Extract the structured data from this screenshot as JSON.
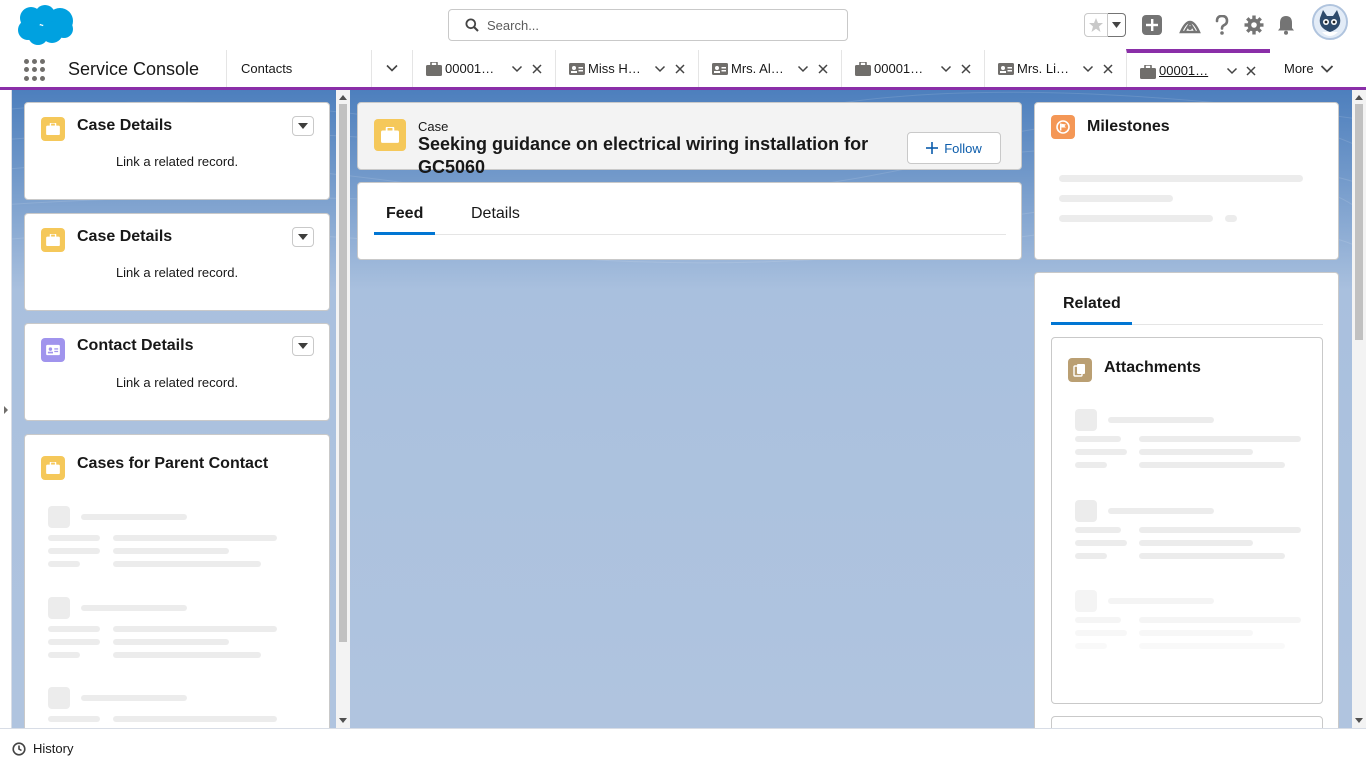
{
  "header": {
    "search_placeholder": "Search...",
    "icons": [
      "salesforce-cloud-logo",
      "search-icon",
      "favorites-star-icon",
      "favorites-dropdown-icon",
      "global-actions-add-icon",
      "trailhead-icon",
      "help-icon",
      "setup-gear-icon",
      "notifications-bell-icon",
      "user-avatar"
    ]
  },
  "nav": {
    "app_name": "Service Console",
    "object_selector": "Contacts",
    "tabs": [
      {
        "label": "00001…",
        "icon": "case-icon"
      },
      {
        "label": "Miss H…",
        "icon": "contact-icon"
      },
      {
        "label": "Mrs. Al…",
        "icon": "contact-icon"
      },
      {
        "label": "00001…",
        "icon": "case-icon"
      },
      {
        "label": "Mrs. Li…",
        "icon": "contact-icon"
      },
      {
        "label": "00001…",
        "icon": "case-icon",
        "active": true
      }
    ],
    "more_label": "More",
    "accent_color": "#8a2fa8"
  },
  "left": {
    "cards": [
      {
        "title": "Case Details",
        "message": "Link a related record."
      },
      {
        "title": "Case Details",
        "message": "Link a related record."
      },
      {
        "title": "Contact Details",
        "message": "Link a related record."
      },
      {
        "title": "Cases for Parent Contact"
      }
    ]
  },
  "center": {
    "record_type": "Case",
    "record_title": "Seeking guidance on electrical wiring installation for GC5060",
    "follow_label": "Follow",
    "tabs": [
      {
        "label": "Feed",
        "active": true
      },
      {
        "label": "Details",
        "active": false
      }
    ]
  },
  "right": {
    "milestones_title": "Milestones",
    "related_tab": "Related",
    "attachments_title": "Attachments"
  },
  "footer": {
    "history_label": "History"
  },
  "colors": {
    "case_icon": "#f5c85a",
    "contact_icon": "#a094ed",
    "milestone_icon": "#f49756",
    "attachment_icon": "#ba9f73",
    "link_blue": "#0b5cab",
    "active_tab_underline": "#0176d3"
  }
}
